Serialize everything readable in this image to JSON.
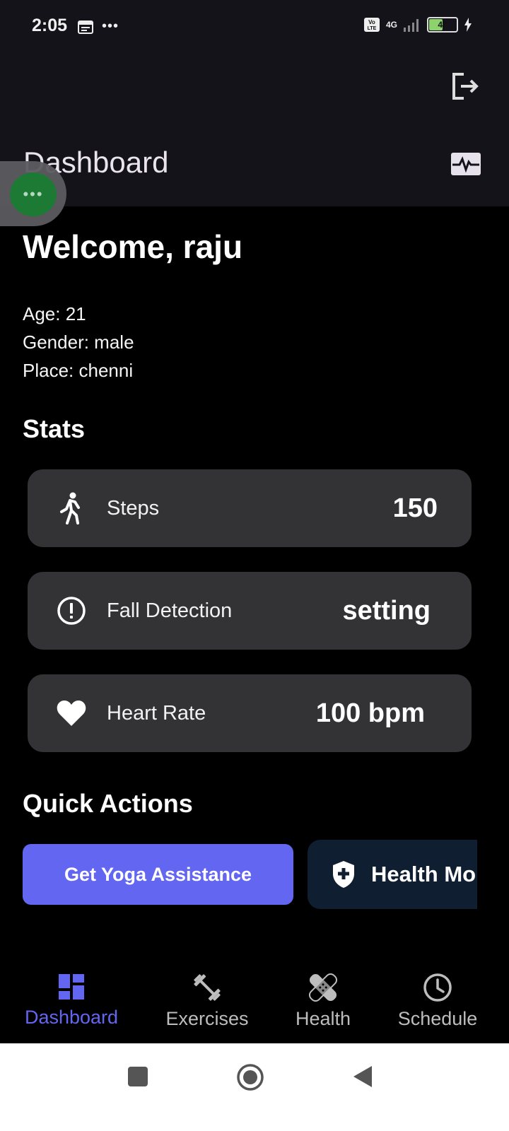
{
  "status_bar": {
    "time": "2:05",
    "battery": "47",
    "network": "4G"
  },
  "app_bar": {
    "title": "Dashboard"
  },
  "floating_bubble": {
    "glyph": "•••"
  },
  "welcome": {
    "text": "Welcome, raju",
    "age": "Age: 21",
    "gender": "Gender: male",
    "place": "Place: chenni"
  },
  "stats": {
    "title": "Stats",
    "items": [
      {
        "label": "Steps",
        "value": "150",
        "icon": "walking-icon"
      },
      {
        "label": "Fall Detection",
        "value": "setting",
        "icon": "alert-circle-icon"
      },
      {
        "label": "Heart Rate",
        "value": "100 bpm",
        "icon": "heart-icon"
      }
    ]
  },
  "quick_actions": {
    "title": "Quick Actions",
    "yoga_label": "Get Yoga Assistance",
    "health_label": "Health Mo"
  },
  "bottom_nav": {
    "items": [
      {
        "label": "Dashboard",
        "icon": "dashboard-icon",
        "active": true
      },
      {
        "label": "Exercises",
        "icon": "dumbbell-icon",
        "active": false
      },
      {
        "label": "Health",
        "icon": "bandage-icon",
        "active": false
      },
      {
        "label": "Schedule",
        "icon": "clock-icon",
        "active": false
      }
    ]
  },
  "colors": {
    "accent": "#6366f1",
    "card": "#333335",
    "appbar": "#15131a",
    "health_button": "#0f1e30"
  }
}
